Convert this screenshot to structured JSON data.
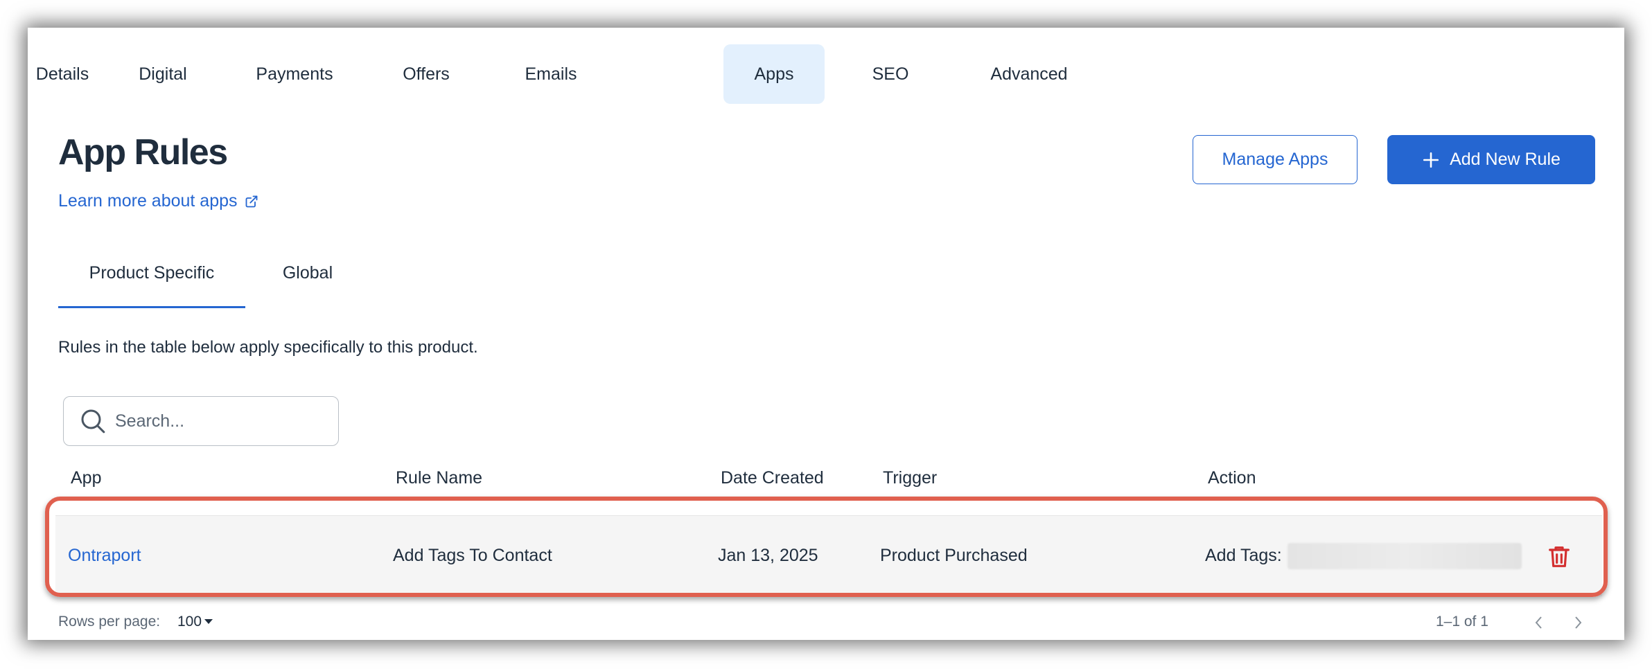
{
  "nav_tabs": [
    {
      "label": "Details"
    },
    {
      "label": "Digital"
    },
    {
      "label": "Payments"
    },
    {
      "label": "Offers"
    },
    {
      "label": "Emails"
    },
    {
      "label": "Apps",
      "active": true
    },
    {
      "label": "SEO"
    },
    {
      "label": "Advanced"
    }
  ],
  "header": {
    "title": "App Rules",
    "learn_more": "Learn more about apps",
    "learn_more_icon": "external-link-icon",
    "manage_apps": "Manage Apps",
    "add_new_rule": "Add New Rule",
    "add_icon": "plus-icon"
  },
  "sub_tabs": [
    {
      "label": "Product Specific",
      "active": true
    },
    {
      "label": "Global"
    }
  ],
  "description": "Rules in the table below apply specifically to this product.",
  "search": {
    "placeholder": "Search...",
    "icon": "search-icon"
  },
  "table": {
    "columns": [
      "App",
      "Rule Name",
      "Date Created",
      "Trigger",
      "Action"
    ],
    "rows": [
      {
        "app": "Ontraport",
        "rule_name": "Add Tags To Contact",
        "date_created": "Jan 13, 2025",
        "trigger": "Product Purchased",
        "action": "Add Tags:",
        "delete_icon": "trash-icon"
      }
    ]
  },
  "footer": {
    "rows_per_page_label": "Rows per page:",
    "rows_per_page_value": "100",
    "range": "1–1 of 1"
  },
  "colors": {
    "accent": "#2566d1",
    "active_tab_bg": "#e3f0fd",
    "highlight_border": "#e0604f",
    "delete": "#d32f2f"
  }
}
